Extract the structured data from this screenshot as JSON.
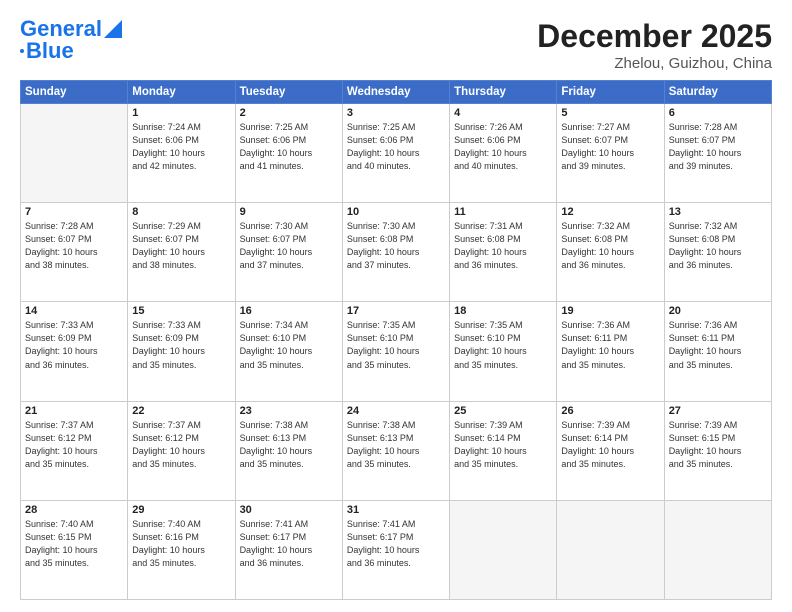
{
  "header": {
    "logo_line1": "General",
    "logo_line2": "Blue",
    "title": "December 2025",
    "subtitle": "Zhelou, Guizhou, China"
  },
  "days_header": [
    "Sunday",
    "Monday",
    "Tuesday",
    "Wednesday",
    "Thursday",
    "Friday",
    "Saturday"
  ],
  "weeks": [
    [
      {
        "num": "",
        "info": ""
      },
      {
        "num": "1",
        "info": "Sunrise: 7:24 AM\nSunset: 6:06 PM\nDaylight: 10 hours\nand 42 minutes."
      },
      {
        "num": "2",
        "info": "Sunrise: 7:25 AM\nSunset: 6:06 PM\nDaylight: 10 hours\nand 41 minutes."
      },
      {
        "num": "3",
        "info": "Sunrise: 7:25 AM\nSunset: 6:06 PM\nDaylight: 10 hours\nand 40 minutes."
      },
      {
        "num": "4",
        "info": "Sunrise: 7:26 AM\nSunset: 6:06 PM\nDaylight: 10 hours\nand 40 minutes."
      },
      {
        "num": "5",
        "info": "Sunrise: 7:27 AM\nSunset: 6:07 PM\nDaylight: 10 hours\nand 39 minutes."
      },
      {
        "num": "6",
        "info": "Sunrise: 7:28 AM\nSunset: 6:07 PM\nDaylight: 10 hours\nand 39 minutes."
      }
    ],
    [
      {
        "num": "7",
        "info": "Sunrise: 7:28 AM\nSunset: 6:07 PM\nDaylight: 10 hours\nand 38 minutes."
      },
      {
        "num": "8",
        "info": "Sunrise: 7:29 AM\nSunset: 6:07 PM\nDaylight: 10 hours\nand 38 minutes."
      },
      {
        "num": "9",
        "info": "Sunrise: 7:30 AM\nSunset: 6:07 PM\nDaylight: 10 hours\nand 37 minutes."
      },
      {
        "num": "10",
        "info": "Sunrise: 7:30 AM\nSunset: 6:08 PM\nDaylight: 10 hours\nand 37 minutes."
      },
      {
        "num": "11",
        "info": "Sunrise: 7:31 AM\nSunset: 6:08 PM\nDaylight: 10 hours\nand 36 minutes."
      },
      {
        "num": "12",
        "info": "Sunrise: 7:32 AM\nSunset: 6:08 PM\nDaylight: 10 hours\nand 36 minutes."
      },
      {
        "num": "13",
        "info": "Sunrise: 7:32 AM\nSunset: 6:08 PM\nDaylight: 10 hours\nand 36 minutes."
      }
    ],
    [
      {
        "num": "14",
        "info": "Sunrise: 7:33 AM\nSunset: 6:09 PM\nDaylight: 10 hours\nand 36 minutes."
      },
      {
        "num": "15",
        "info": "Sunrise: 7:33 AM\nSunset: 6:09 PM\nDaylight: 10 hours\nand 35 minutes."
      },
      {
        "num": "16",
        "info": "Sunrise: 7:34 AM\nSunset: 6:10 PM\nDaylight: 10 hours\nand 35 minutes."
      },
      {
        "num": "17",
        "info": "Sunrise: 7:35 AM\nSunset: 6:10 PM\nDaylight: 10 hours\nand 35 minutes."
      },
      {
        "num": "18",
        "info": "Sunrise: 7:35 AM\nSunset: 6:10 PM\nDaylight: 10 hours\nand 35 minutes."
      },
      {
        "num": "19",
        "info": "Sunrise: 7:36 AM\nSunset: 6:11 PM\nDaylight: 10 hours\nand 35 minutes."
      },
      {
        "num": "20",
        "info": "Sunrise: 7:36 AM\nSunset: 6:11 PM\nDaylight: 10 hours\nand 35 minutes."
      }
    ],
    [
      {
        "num": "21",
        "info": "Sunrise: 7:37 AM\nSunset: 6:12 PM\nDaylight: 10 hours\nand 35 minutes."
      },
      {
        "num": "22",
        "info": "Sunrise: 7:37 AM\nSunset: 6:12 PM\nDaylight: 10 hours\nand 35 minutes."
      },
      {
        "num": "23",
        "info": "Sunrise: 7:38 AM\nSunset: 6:13 PM\nDaylight: 10 hours\nand 35 minutes."
      },
      {
        "num": "24",
        "info": "Sunrise: 7:38 AM\nSunset: 6:13 PM\nDaylight: 10 hours\nand 35 minutes."
      },
      {
        "num": "25",
        "info": "Sunrise: 7:39 AM\nSunset: 6:14 PM\nDaylight: 10 hours\nand 35 minutes."
      },
      {
        "num": "26",
        "info": "Sunrise: 7:39 AM\nSunset: 6:14 PM\nDaylight: 10 hours\nand 35 minutes."
      },
      {
        "num": "27",
        "info": "Sunrise: 7:39 AM\nSunset: 6:15 PM\nDaylight: 10 hours\nand 35 minutes."
      }
    ],
    [
      {
        "num": "28",
        "info": "Sunrise: 7:40 AM\nSunset: 6:15 PM\nDaylight: 10 hours\nand 35 minutes."
      },
      {
        "num": "29",
        "info": "Sunrise: 7:40 AM\nSunset: 6:16 PM\nDaylight: 10 hours\nand 35 minutes."
      },
      {
        "num": "30",
        "info": "Sunrise: 7:41 AM\nSunset: 6:17 PM\nDaylight: 10 hours\nand 36 minutes."
      },
      {
        "num": "31",
        "info": "Sunrise: 7:41 AM\nSunset: 6:17 PM\nDaylight: 10 hours\nand 36 minutes."
      },
      {
        "num": "",
        "info": ""
      },
      {
        "num": "",
        "info": ""
      },
      {
        "num": "",
        "info": ""
      }
    ]
  ]
}
